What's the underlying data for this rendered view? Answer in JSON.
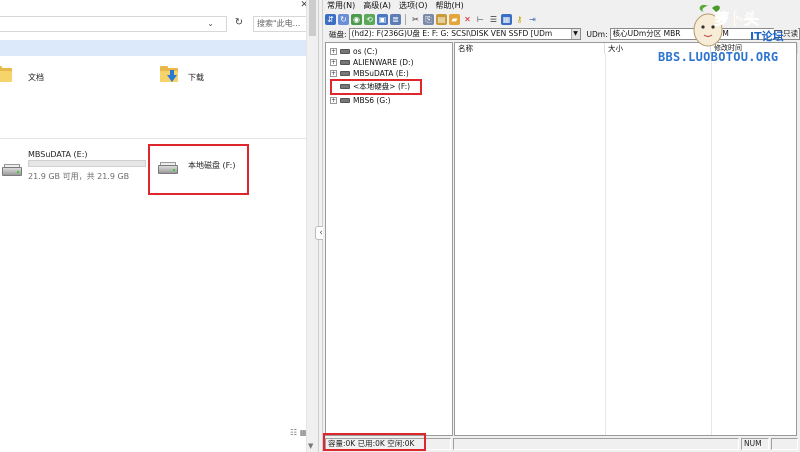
{
  "explorer": {
    "close_glyph": "✕",
    "search_placeholder": "搜索\"此电...",
    "folders": [
      {
        "label": "文档"
      },
      {
        "label": "下载"
      }
    ],
    "drives": [
      {
        "name": "MBSuDATA (E:)",
        "space": "21.9 GB 可用，共 21.9 GB",
        "used_fraction": 0.0
      },
      {
        "name": "本地磁盘 (F:)"
      }
    ]
  },
  "diskapp": {
    "menu": [
      "常用(N)",
      "高级(A)",
      "选项(O)",
      "帮助(H)"
    ],
    "disk_label": "磁盘:",
    "disk_value": "(hd2): F(236G)U盘  E: F: G: SCSI\\DISK  VEN SSFD [UDm",
    "udm_label": "UDm:",
    "udm_value": "核心UDm分区 MBR",
    "udm_value_tail": "48M",
    "checkbox_label": "只读",
    "tree": [
      {
        "label": "os (C:)",
        "expander": "+"
      },
      {
        "label": "ALIENWARE (D:)",
        "expander": "+"
      },
      {
        "label": "MBSuDATA (E:)",
        "expander": "+"
      },
      {
        "label": "<本地硬盘> (F:)",
        "expander": ""
      },
      {
        "label": "MBS6 (G:)",
        "expander": "+"
      }
    ],
    "columns": [
      "名称",
      "大小",
      "修改时间"
    ],
    "status": {
      "capacity": "容量:0K 已用:0K 空闲:0K",
      "num": "NUM"
    }
  },
  "watermark": {
    "title": "萝卜头",
    "sub": "IT论坛",
    "url": "BBS.LUOBOTOU.ORG"
  },
  "colors": {
    "highlight_box": "#e0262d",
    "selection_bar": "#dbe9fa",
    "capacity_fill": "#26a0da"
  }
}
